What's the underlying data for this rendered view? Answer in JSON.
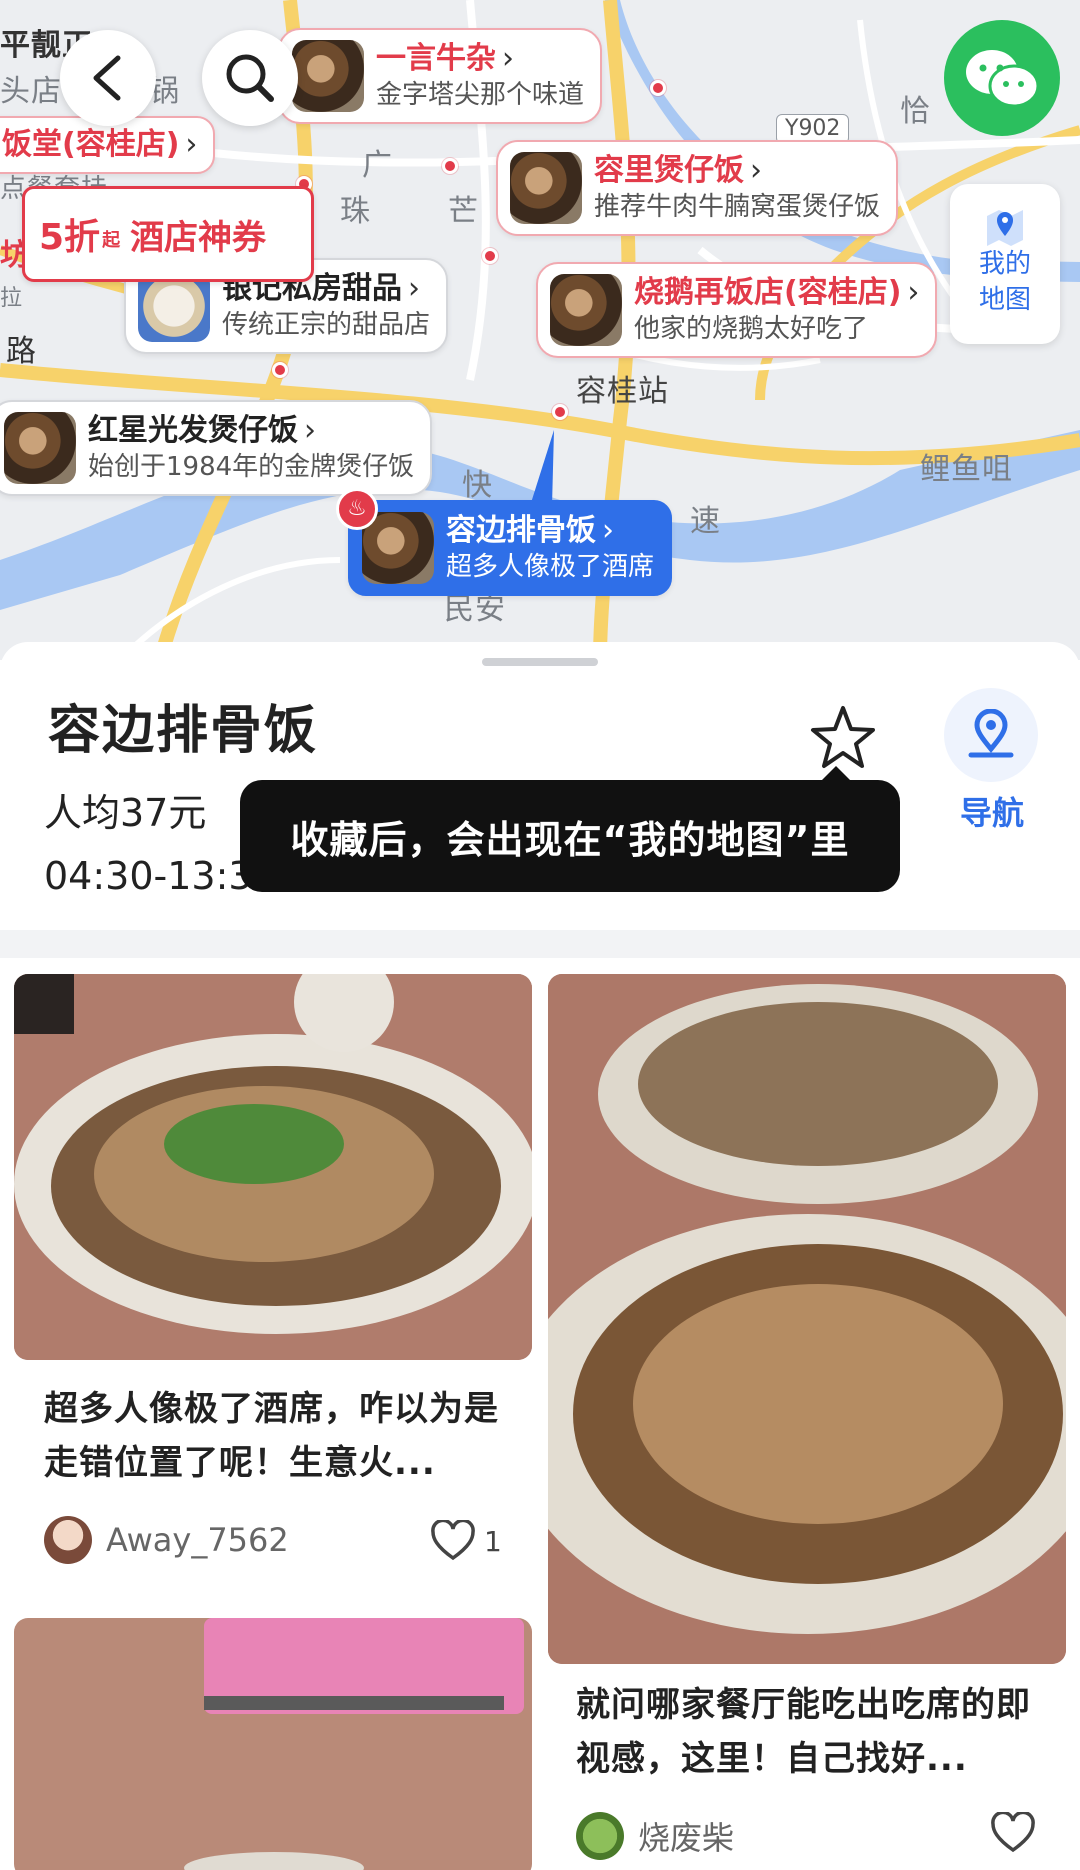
{
  "map": {
    "labels": [
      "平靓正",
      "头店",
      "火锅",
      "广",
      "珠",
      "芒",
      "恰",
      "路",
      "容桂站",
      "快",
      "速",
      "鲤鱼咀",
      "民安",
      "坊",
      "拉",
      "点餐套挂"
    ],
    "road_tag": "Y902",
    "coupon": {
      "discount": "5折",
      "suffix": "起",
      "label": "酒店神券"
    },
    "my_map_label": "我的地图",
    "places": [
      {
        "name": "一言牛杂",
        "desc": "金字塔尖那个味道"
      },
      {
        "name": "饭堂(容桂店)",
        "desc": ""
      },
      {
        "name": "容里煲仔饭",
        "desc": "推荐牛肉牛腩窝蛋煲仔饭"
      },
      {
        "name": "银记私房甜品",
        "desc": "传统正宗的甜品店"
      },
      {
        "name": "烧鹅再饭店(容桂店)",
        "desc": "他家的烧鹅太好吃了"
      },
      {
        "name": "红星光发煲仔饭",
        "desc": "始创于1984年的金牌煲仔饭"
      },
      {
        "name": "容边排骨饭",
        "desc": "超多人像极了酒席"
      }
    ]
  },
  "place": {
    "title": "容边排骨饭",
    "price": "人均37元",
    "hours": "04:30-13:3",
    "nav_label": "导航"
  },
  "tooltip": "收藏后，会出现在“我的地图”里",
  "feed": [
    {
      "title": "超多人像极了酒席，咋以为是走错位置了呢！生意火...",
      "user": "Away_7562",
      "likes": "1"
    },
    {
      "title": "就问哪家餐厅能吃出吃席的即视感，这里！自己找好...",
      "user": "烧废柴",
      "likes": ""
    }
  ],
  "colors": {
    "accent_blue": "#2f6fe8",
    "accent_red": "#e23b4a",
    "wechat_green": "#2bbf5e"
  },
  "icons": [
    "back-icon",
    "search-icon",
    "wechat-icon",
    "map-pin-icon",
    "star-icon",
    "navigation-icon",
    "heart-icon",
    "fire-icon",
    "chevron-right-icon"
  ]
}
